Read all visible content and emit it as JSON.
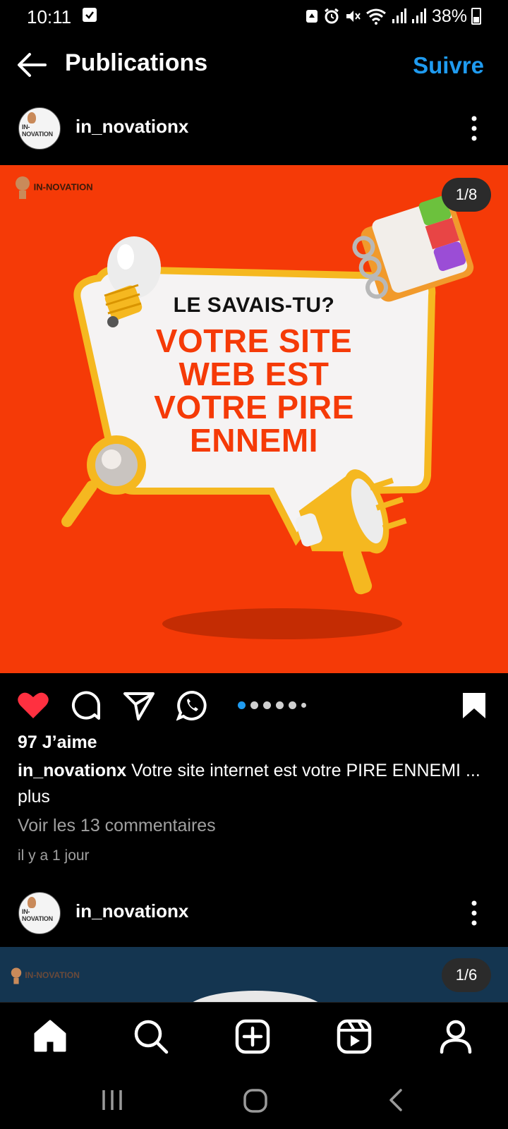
{
  "status_bar": {
    "time": "10:11",
    "battery": "38%"
  },
  "header": {
    "title": "Publications",
    "follow_label": "Suivre"
  },
  "post": {
    "username": "in_novationx",
    "image": {
      "brand_logo": "IN-NOVATION",
      "page_counter": "1/8",
      "kicker": "LE SAVAIS-TU?",
      "headline_lines": [
        "VOTRE SITE",
        "WEB EST",
        "VOTRE PIRE",
        "ENNEMI"
      ]
    },
    "carousel": {
      "count": 6,
      "active_index": 0
    },
    "likes": "97 J’aime",
    "caption_user": "in_novationx",
    "caption_text": "Votre site internet est votre PIRE ENNEMI",
    "caption_more": "... plus",
    "comments_link": "Voir les 13 commentaires",
    "timestamp": "il y a 1 jour",
    "colors": {
      "background": "#f53a07",
      "accent": "#f5b820",
      "like": "#ff3040"
    }
  },
  "post2": {
    "username": "in_novationx",
    "image": {
      "brand_logo": "IN-NOVATION",
      "page_counter": "1/6"
    }
  },
  "bottom_nav": {
    "items": [
      "home-icon",
      "search-icon",
      "create-icon",
      "reels-icon",
      "profile-icon"
    ]
  },
  "accent_color": "#1f9bf0"
}
